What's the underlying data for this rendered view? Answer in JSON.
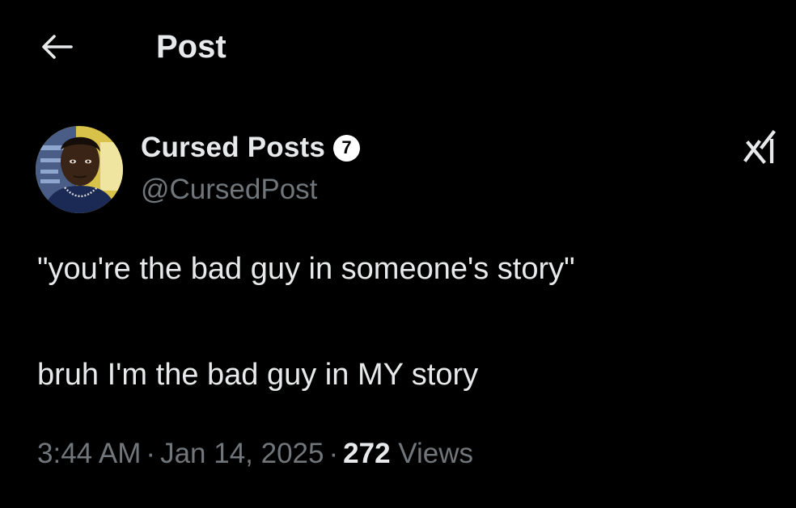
{
  "header": {
    "back_icon": "arrow-left-icon",
    "title": "Post"
  },
  "author": {
    "name": "Cursed Posts",
    "badge": "7",
    "handle": "@CursedPost",
    "avatar_icon": "user-avatar"
  },
  "grok_icon": "grok-icon",
  "post": {
    "line1": "\"you're the bad guy in someone's story\"",
    "line2": "bruh I'm the bad guy in MY story"
  },
  "meta": {
    "time": "3:44 AM",
    "separator": "·",
    "date": "Jan 14, 2025",
    "views_count": "272",
    "views_label": "Views"
  },
  "colors": {
    "background": "#000000",
    "text_primary": "#e7e9ea",
    "text_secondary": "#71767b"
  }
}
